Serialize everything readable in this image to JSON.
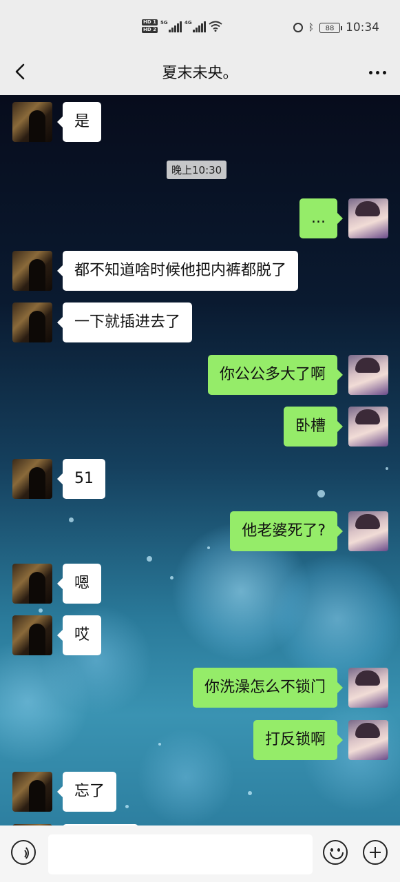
{
  "status_bar": {
    "hd1": "HD 1",
    "hd2": "HD 2",
    "net1": "5G",
    "net2": "4G",
    "battery": "88",
    "time": "10:34"
  },
  "header": {
    "title": "夏末未央。"
  },
  "chat": {
    "timestamp": "晚上10:30",
    "messages": [
      {
        "side": "in",
        "text": "是"
      },
      {
        "side": "out",
        "text": "..."
      },
      {
        "side": "in",
        "text": "都不知道啥时候他把内裤都脱了"
      },
      {
        "side": "in",
        "text": "一下就插进去了"
      },
      {
        "side": "out",
        "text": "你公公多大了啊"
      },
      {
        "side": "out",
        "text": "卧槽"
      },
      {
        "side": "in",
        "text": "51"
      },
      {
        "side": "out",
        "text": "他老婆死了?"
      },
      {
        "side": "in",
        "text": "嗯"
      },
      {
        "side": "in",
        "text": "哎"
      },
      {
        "side": "out",
        "text": "你洗澡怎么不锁门"
      },
      {
        "side": "out",
        "text": "打反锁啊"
      },
      {
        "side": "in",
        "text": "忘了"
      }
    ]
  },
  "colors": {
    "outgoing_bubble": "#95ec69",
    "incoming_bubble": "#ffffff",
    "bar_background": "#ededed"
  }
}
